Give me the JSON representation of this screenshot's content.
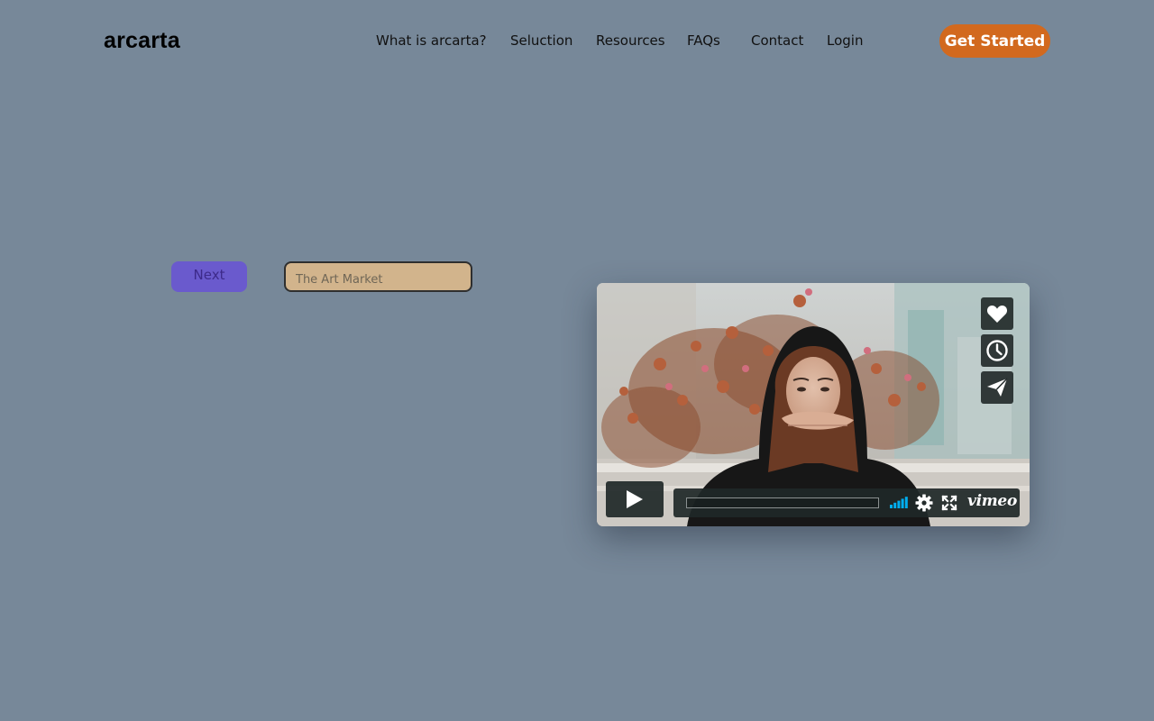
{
  "header": {
    "logo": "arcarta",
    "nav": [
      {
        "label": "What is arcarta?"
      },
      {
        "label": "Seluction"
      },
      {
        "label": "Resources"
      },
      {
        "label": "FAQs"
      },
      {
        "label": "Contact"
      },
      {
        "label": "Login"
      }
    ],
    "cta_label": "Get Started"
  },
  "controls": {
    "next_label": "Next",
    "search_placeholder": "The Art Market"
  },
  "video": {
    "side_buttons": [
      "heart-icon",
      "clock-icon",
      "send-icon"
    ],
    "progress": 0,
    "volume_bars": 5,
    "brand": "vimeo"
  },
  "colors": {
    "background": "#778899",
    "cta": "#d2691e",
    "next_button": "#6a5acd",
    "input_background": "#d2b48c",
    "player_accent": "#00adef"
  }
}
